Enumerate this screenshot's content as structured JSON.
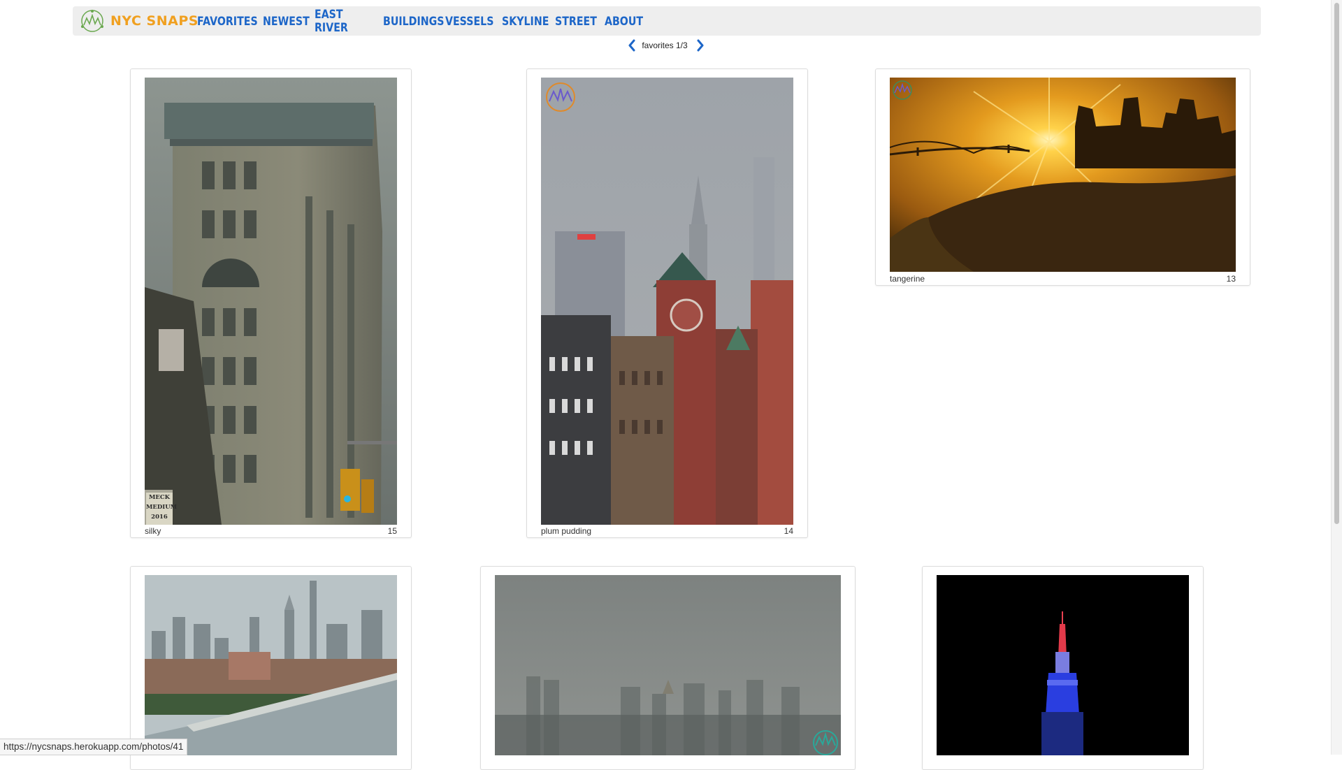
{
  "app": {
    "brand": "NYC SNAPS",
    "logo_icon": "nyc-snaps-logo-icon"
  },
  "nav": {
    "links": [
      "FAVORITES",
      "NEWEST",
      "EAST RIVER",
      "BUILDINGS",
      "VESSELS",
      "SKYLINE",
      "STREET",
      "ABOUT"
    ]
  },
  "pager": {
    "text": "favorites 1/3",
    "prev_icon": "chevron-left-icon",
    "next_icon": "chevron-right-icon"
  },
  "photos": [
    {
      "title": "silky",
      "count": "15"
    },
    {
      "title": "plum pudding",
      "count": "14"
    },
    {
      "title": "tangerine",
      "count": "13"
    },
    {
      "title": "",
      "count": ""
    },
    {
      "title": "",
      "count": ""
    },
    {
      "title": "",
      "count": ""
    }
  ],
  "watermark": {
    "stamp_lines": [
      "MECK",
      "MEDIUM",
      "2016"
    ]
  },
  "status_bar": {
    "url": "https://nycsnaps.herokuapp.com/photos/41"
  },
  "colors": {
    "brand": "#f0a020",
    "link": "#1d66c8",
    "navbar_bg": "#eeeeee"
  }
}
